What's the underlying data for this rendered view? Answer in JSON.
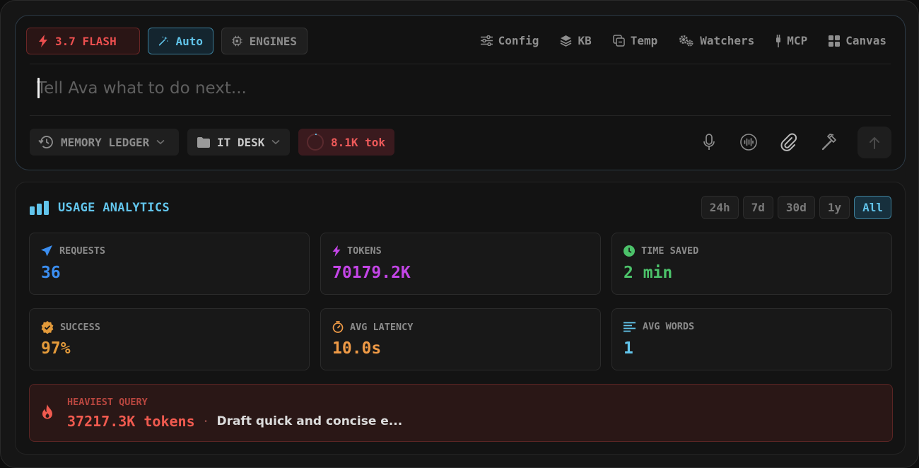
{
  "composer": {
    "model_chip": "3.7 FLASH",
    "auto_chip": "Auto",
    "engines_chip": "ENGINES",
    "toplinks": [
      "Config",
      "KB",
      "Temp",
      "Watchers",
      "MCP",
      "Canvas"
    ],
    "placeholder": "Tell Ava what to do next...",
    "memory_pill": "MEMORY LEDGER",
    "workspace_pill": "IT DESK",
    "token_pill": "8.1K tok"
  },
  "analytics": {
    "title": "USAGE ANALYTICS",
    "ranges": [
      "24h",
      "7d",
      "30d",
      "1y",
      "All"
    ],
    "active_range": "All",
    "cards": [
      {
        "label": "REQUESTS",
        "value": "36",
        "color": "#3b8ef0"
      },
      {
        "label": "TOKENS",
        "value": "70179.2K",
        "color": "#c345e6"
      },
      {
        "label": "TIME SAVED",
        "value": "2 min",
        "color": "#4cc26a"
      },
      {
        "label": "SUCCESS",
        "value": "97%",
        "color": "#e39a3a"
      },
      {
        "label": "AVG LATENCY",
        "value": "10.0s",
        "color": "#ef9a46"
      },
      {
        "label": "AVG WORDS",
        "value": "1",
        "color": "#62c5ec"
      }
    ],
    "heaviest": {
      "label": "HEAVIEST QUERY",
      "tokens": "37217.3K tokens",
      "separator": "·",
      "query": "Draft quick and concise e..."
    }
  }
}
